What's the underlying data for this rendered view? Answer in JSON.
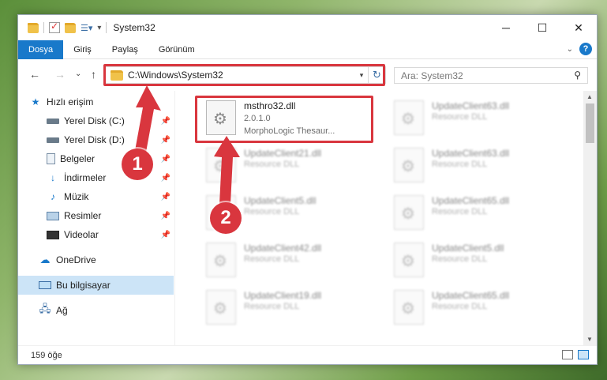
{
  "window": {
    "title": "System32",
    "controls": {
      "minimize": "─",
      "maximize": "☐",
      "close": "✕"
    }
  },
  "ribbon": {
    "tabs": [
      "Dosya",
      "Giriş",
      "Paylaş",
      "Görünüm"
    ],
    "help": "?"
  },
  "nav": {
    "back": "←",
    "forward": "→",
    "recent": "⌄",
    "up": "↑",
    "address": "C:\\Windows\\System32",
    "search_placeholder": "Ara: System32"
  },
  "sidebar": {
    "items": [
      {
        "label": "Hızlı erişim",
        "icon": "star-icon"
      },
      {
        "label": "Yerel Disk (C:)",
        "icon": "drive-icon",
        "pinned": true
      },
      {
        "label": "Yerel Disk (D:)",
        "icon": "drive-icon",
        "pinned": true
      },
      {
        "label": "Belgeler",
        "icon": "document-icon",
        "pinned": true
      },
      {
        "label": "İndirmeler",
        "icon": "download-icon",
        "pinned": true
      },
      {
        "label": "Müzik",
        "icon": "music-icon",
        "pinned": true
      },
      {
        "label": "Resimler",
        "icon": "picture-icon",
        "pinned": true
      },
      {
        "label": "Videolar",
        "icon": "video-icon",
        "pinned": true
      },
      {
        "label": "OneDrive",
        "icon": "cloud-icon"
      },
      {
        "label": "Bu bilgisayar",
        "icon": "computer-icon",
        "selected": true
      },
      {
        "label": "Ağ",
        "icon": "network-icon"
      }
    ]
  },
  "files": {
    "highlighted": {
      "name": "msthro32.dll",
      "version": "2.0.1.0",
      "description": "MorphoLogic Thesaur..."
    },
    "blurred": [
      {
        "name": "UpdateClient63.dll",
        "type": "Resource DLL"
      },
      {
        "name": "UpdateClient21.dll",
        "type": "Resource DLL"
      },
      {
        "name": "UpdateClient63.dll",
        "type": "Resource DLL"
      },
      {
        "name": "UpdateClient5.dll",
        "type": "Resource DLL"
      },
      {
        "name": "UpdateClient65.dll",
        "type": "Resource DLL"
      },
      {
        "name": "UpdateClient42.dll",
        "type": "Resource DLL"
      },
      {
        "name": "UpdateClient5.dll",
        "type": "Resource DLL"
      },
      {
        "name": "UpdateClient19.dll",
        "type": "Resource DLL"
      },
      {
        "name": "UpdateClient65.dll",
        "type": "Resource DLL"
      }
    ]
  },
  "status": {
    "item_count": "159 öğe"
  },
  "annotations": {
    "step1": "1",
    "step2": "2",
    "color": "#d9363e"
  }
}
